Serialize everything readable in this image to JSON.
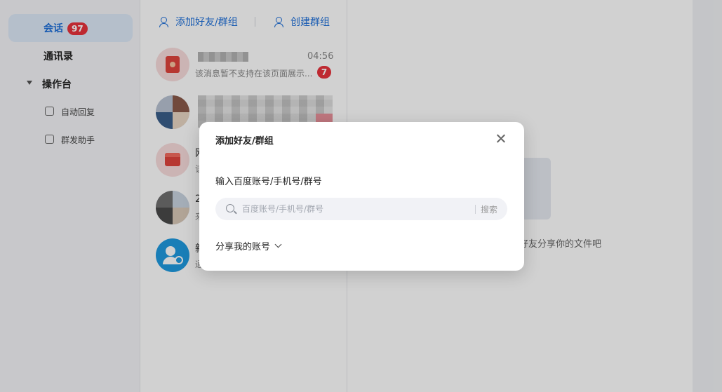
{
  "sidebar": {
    "items": [
      {
        "label": "会话",
        "badge": "97",
        "active": true
      },
      {
        "label": "通讯录"
      },
      {
        "label": "操作台"
      }
    ],
    "sub_items": [
      {
        "label": "自动回复",
        "icon": "auto-reply-icon"
      },
      {
        "label": "群发助手",
        "icon": "broadcast-icon"
      }
    ]
  },
  "toolbar": {
    "add_label": "添加好友/群组",
    "create_group_label": "创建群组"
  },
  "conversations": [
    {
      "time": "04:56",
      "preview": "该消息暂不支持在该页面展示...",
      "badge": "7"
    },
    {
      "fragment": ""
    },
    {
      "fragment": "网",
      "preview": "该"
    },
    {
      "fragment": "2",
      "preview": "来"
    },
    {
      "fragment": "新",
      "preview": "通"
    }
  ],
  "content": {
    "empty_text": "好友分享你的文件吧"
  },
  "modal": {
    "title": "添加好友/群组",
    "label": "输入百度账号/手机号/群号",
    "search_placeholder": "百度账号/手机号/群号",
    "search_button": "搜索",
    "share_label": "分享我的账号"
  },
  "colors": {
    "accent": "#1e6fd9",
    "badge": "#e8323c",
    "active_bg": "#dde9f8"
  }
}
